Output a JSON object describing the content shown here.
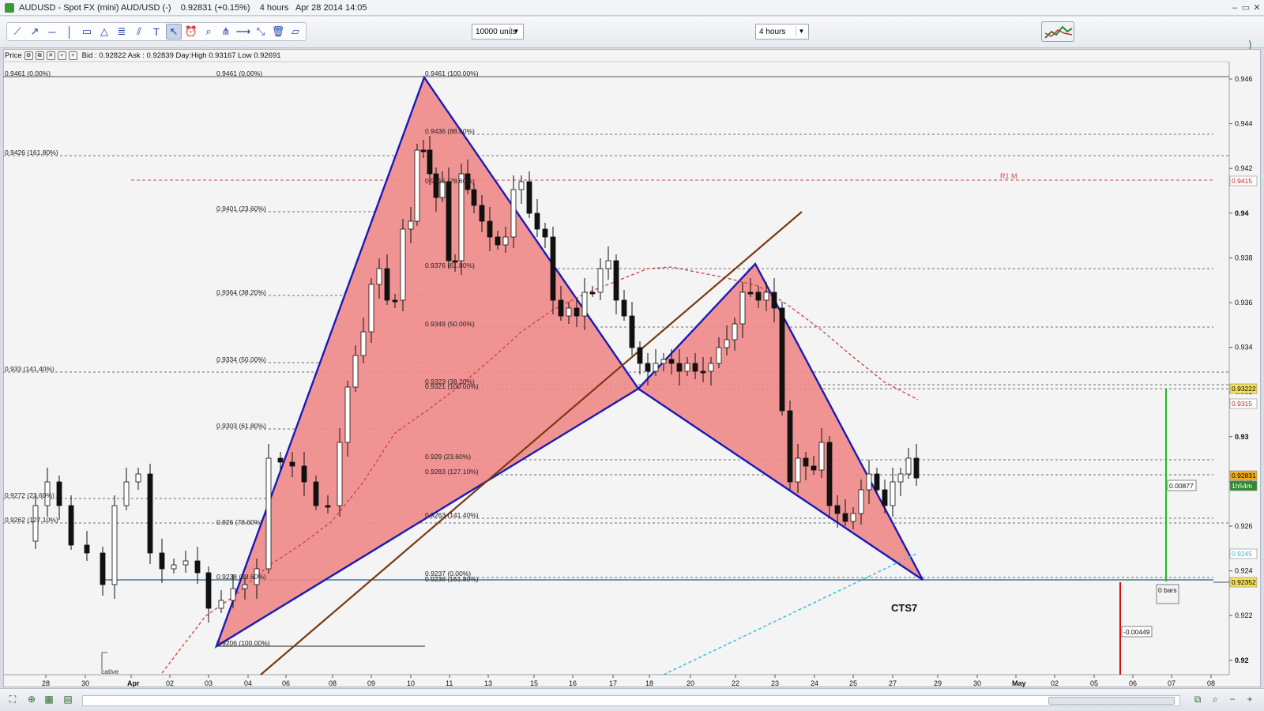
{
  "window": {
    "title": "AUDUSD - Spot FX (mini) AUD/USD (-)    0.92831 (+0.15%)    4 hours   Apr 28 2014 14:05",
    "minimize": "–",
    "maximize": "▭",
    "close": "✕"
  },
  "toolbar": {
    "units_select": "10000 units",
    "timeframe_select": "4 hours",
    "tools": [
      "line-tool-icon",
      "ray-tool-icon",
      "hline-tool-icon",
      "vline-tool-icon",
      "rectangle-tool-icon",
      "triangle-tool-icon",
      "fib-tool-icon",
      "channel-tool-icon",
      "text-tool-icon",
      "pointer-tool-icon",
      "alert-tool-icon",
      "zoom-tool-icon",
      "pitchfork-tool-icon",
      "trend-tool-icon",
      "measure-tool-icon",
      "trash-icon",
      "ruler-icon"
    ]
  },
  "info_bar": {
    "label": "Price",
    "quote": "Bid : 0.92822  Ask : 0.92839  Day:High 0.93167  Low 0.92691"
  },
  "price_axis": {
    "labels": [
      "0.946",
      "0.944",
      "0.942",
      "0.94",
      "0.938",
      "0.936",
      "0.934",
      "0.932",
      "0.93",
      "0.928",
      "0.926",
      "0.924",
      "0.922",
      "0.92"
    ],
    "tags": [
      {
        "text": "0.9415",
        "color": "#c02020",
        "bg": "#ffffff"
      },
      {
        "text": "0.93222",
        "color": "#000000",
        "bg": "#f5e15a"
      },
      {
        "text": "0.9315",
        "color": "#c02020",
        "bg": "#ffffff"
      },
      {
        "text": "0.92831",
        "color": "#000000",
        "bg": "#f0b020"
      },
      {
        "text": "1h54m",
        "color": "#ffffff",
        "bg": "#2e8b2e"
      },
      {
        "text": "0.9245",
        "color": "#39b6c8",
        "bg": "#ffffff"
      },
      {
        "text": "0.92352",
        "color": "#000000",
        "bg": "#f5e15a"
      }
    ]
  },
  "time_axis": {
    "labels": [
      "28",
      "30",
      "Apr",
      "02",
      "03",
      "04",
      "06",
      "08",
      "09",
      "10",
      "11",
      "13",
      "15",
      "16",
      "17",
      "18",
      "20",
      "22",
      "23",
      "24",
      "25",
      "27",
      "29",
      "30",
      "May",
      "02",
      "05",
      "06",
      "07",
      "08"
    ]
  },
  "fib_labels": {
    "left": [
      "0.9461 (0.00%)",
      "0.9426 (161.80%)",
      "0.933 (141.40%)",
      "0.9272 (23.60%)",
      "0.9262 (127.10%)"
    ],
    "mid_a": [
      "0.9461 (0.00%)",
      "0.9401 (23.60%)",
      "0.9364 (38.20%)",
      "0.9334 (50.00%)",
      "0.9303 (61.80%)",
      "0.926 (78.60%)",
      "0.9238 (88.60%)",
      "0.9206 (100.00%)"
    ],
    "mid_b": [
      "0.9461 (100.00%)",
      "0.9436 (88.60%)",
      "0.9415 (78.60%)",
      "0.9376 (61.80%)",
      "0.9349 (50.00%)",
      "0.9323 (38.20%)",
      "0.9321 (100.00%)",
      "0.929 (23.60%)",
      "0.9283 (127.10%)",
      "0.9263 (141.40%)",
      "0.9237 (0.00%)",
      "0.9236 (161.80%)"
    ]
  },
  "annotations": {
    "pattern_label": "CTS7",
    "pivot_label": "R1 M",
    "measure_up": "0.00877",
    "measure_bars": "0 bars",
    "measure_down": "-0.00449",
    "indicator_label": "cative"
  },
  "colors": {
    "pattern_fill": "#f08a88",
    "pattern_line": "#1a1ab8",
    "trendline": "#7a3a10",
    "pivot_line": "#c05050",
    "ma_line": "#d04040",
    "cyan_line": "#39c0d8",
    "green_measure": "#22bb22",
    "red_measure": "#cc1111",
    "horizontal_support": "#2a5a7a"
  }
}
